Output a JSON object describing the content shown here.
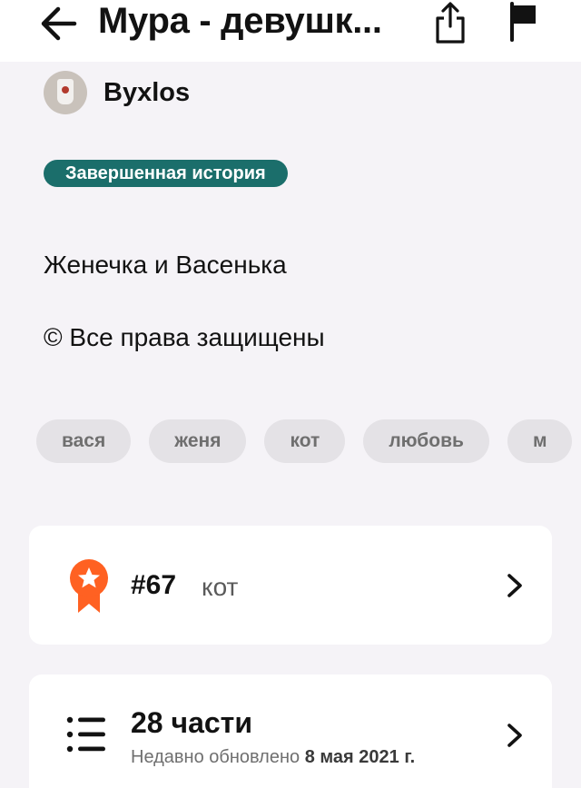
{
  "header": {
    "title": "Мура - девушк...",
    "icons": {
      "back": "arrow-left-icon",
      "share": "share-icon",
      "report": "flag-icon"
    }
  },
  "author": {
    "name": "Byxlos",
    "avatar": "avatar-sock-image"
  },
  "status_badge": {
    "label": "Завершенная история",
    "color": "#1b6e6b"
  },
  "description": "Женечка и Васенька",
  "copyright": "© Все права защищены",
  "tags": [
    "вася",
    "женя",
    "кот",
    "любовь",
    "м"
  ],
  "ranking": {
    "number": "#67",
    "category": "кот",
    "icon": "award-ribbon-icon",
    "accent": "#ff6122"
  },
  "parts": {
    "count": "28 части",
    "updated_prefix": "Недавно обновлено",
    "updated_date": "8 мая 2021 г.",
    "icon": "list-icon"
  },
  "colors": {
    "background": "#f5f3f7",
    "card": "#ffffff",
    "tag_bg": "#e4e2e6"
  }
}
